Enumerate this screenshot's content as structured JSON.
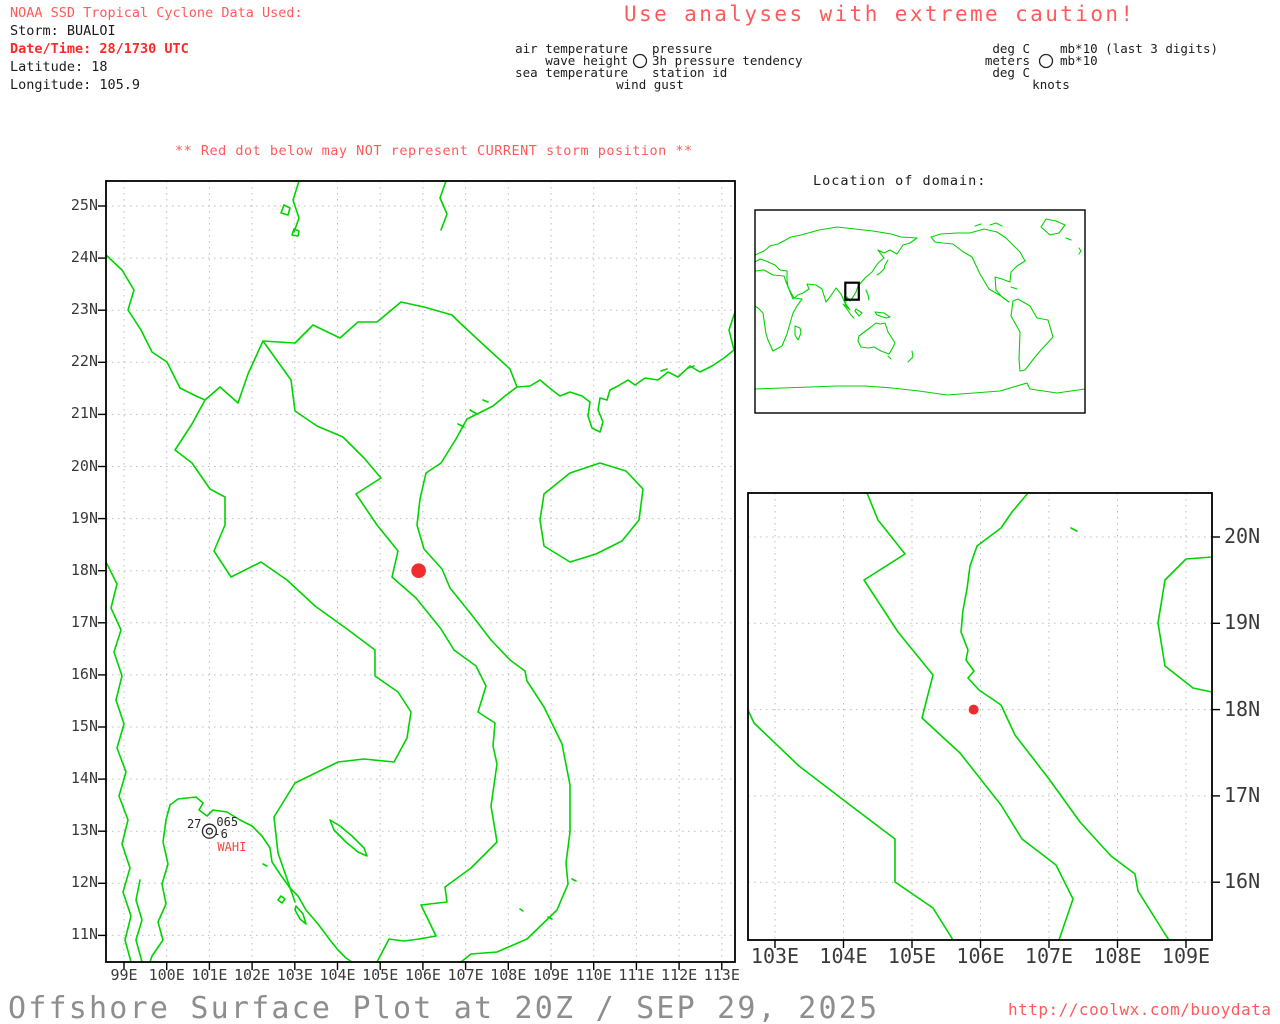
{
  "header": {
    "noaa_line": "NOAA SSD Tropical Cyclone Data Used:",
    "storm_line": "Storm: BUALOI",
    "datetime_line": "Date/Time: 28/1730 UTC",
    "latitude_line": "Latitude: 18",
    "longitude_line": "Longitude: 105.9",
    "caution_title": "Use analyses with extreme caution!"
  },
  "station_legend": {
    "left": [
      "air temperature",
      "wave height",
      "sea temperature"
    ],
    "bottom": "wind gust",
    "right": [
      "pressure",
      "3h pressure tendency",
      "station id"
    ]
  },
  "units_legend": {
    "left": [
      "deg C",
      "meters",
      "deg C"
    ],
    "bottom": "knots",
    "right": [
      "mb*10 (last 3 digits)",
      "mb*10"
    ]
  },
  "warning": "** Red dot below may NOT represent CURRENT storm position **",
  "main_map": {
    "lat_labels": [
      "25N",
      "24N",
      "23N",
      "22N",
      "21N",
      "20N",
      "19N",
      "18N",
      "17N",
      "16N",
      "15N",
      "14N",
      "13N",
      "12N",
      "11N"
    ],
    "lon_labels": [
      "99E",
      "100E",
      "101E",
      "102E",
      "103E",
      "104E",
      "105E",
      "106E",
      "107E",
      "108E",
      "109E",
      "110E",
      "111E",
      "112E",
      "113E"
    ],
    "storm_dot": {
      "lat": 18,
      "lon": 105.9
    },
    "station": {
      "lat": 13,
      "lon": 101,
      "air_temp": "27",
      "pressure": "065",
      "tendency": "-6",
      "station_id": "WAHI"
    }
  },
  "inset_map": {
    "title": "Location of domain:"
  },
  "zoom_map": {
    "lat_labels": [
      "20N",
      "19N",
      "18N",
      "17N",
      "16N"
    ],
    "lon_labels": [
      "103E",
      "104E",
      "105E",
      "106E",
      "107E",
      "108E",
      "109E"
    ],
    "storm_dot": {
      "lat": 18,
      "lon": 105.9
    }
  },
  "footer": {
    "title": "Offshore Surface Plot at 20Z / SEP 29, 2025",
    "url": "http://coolwx.com/buoydata"
  },
  "colors": {
    "coast": "#00d400",
    "grid": "#bdbdbd",
    "light_red": "#ff5a5a",
    "strong_red": "#ff2828",
    "dot_red": "#ee2e2e",
    "axis_gray": "#3a3a3a",
    "title_gray": "#8e8e8e"
  }
}
